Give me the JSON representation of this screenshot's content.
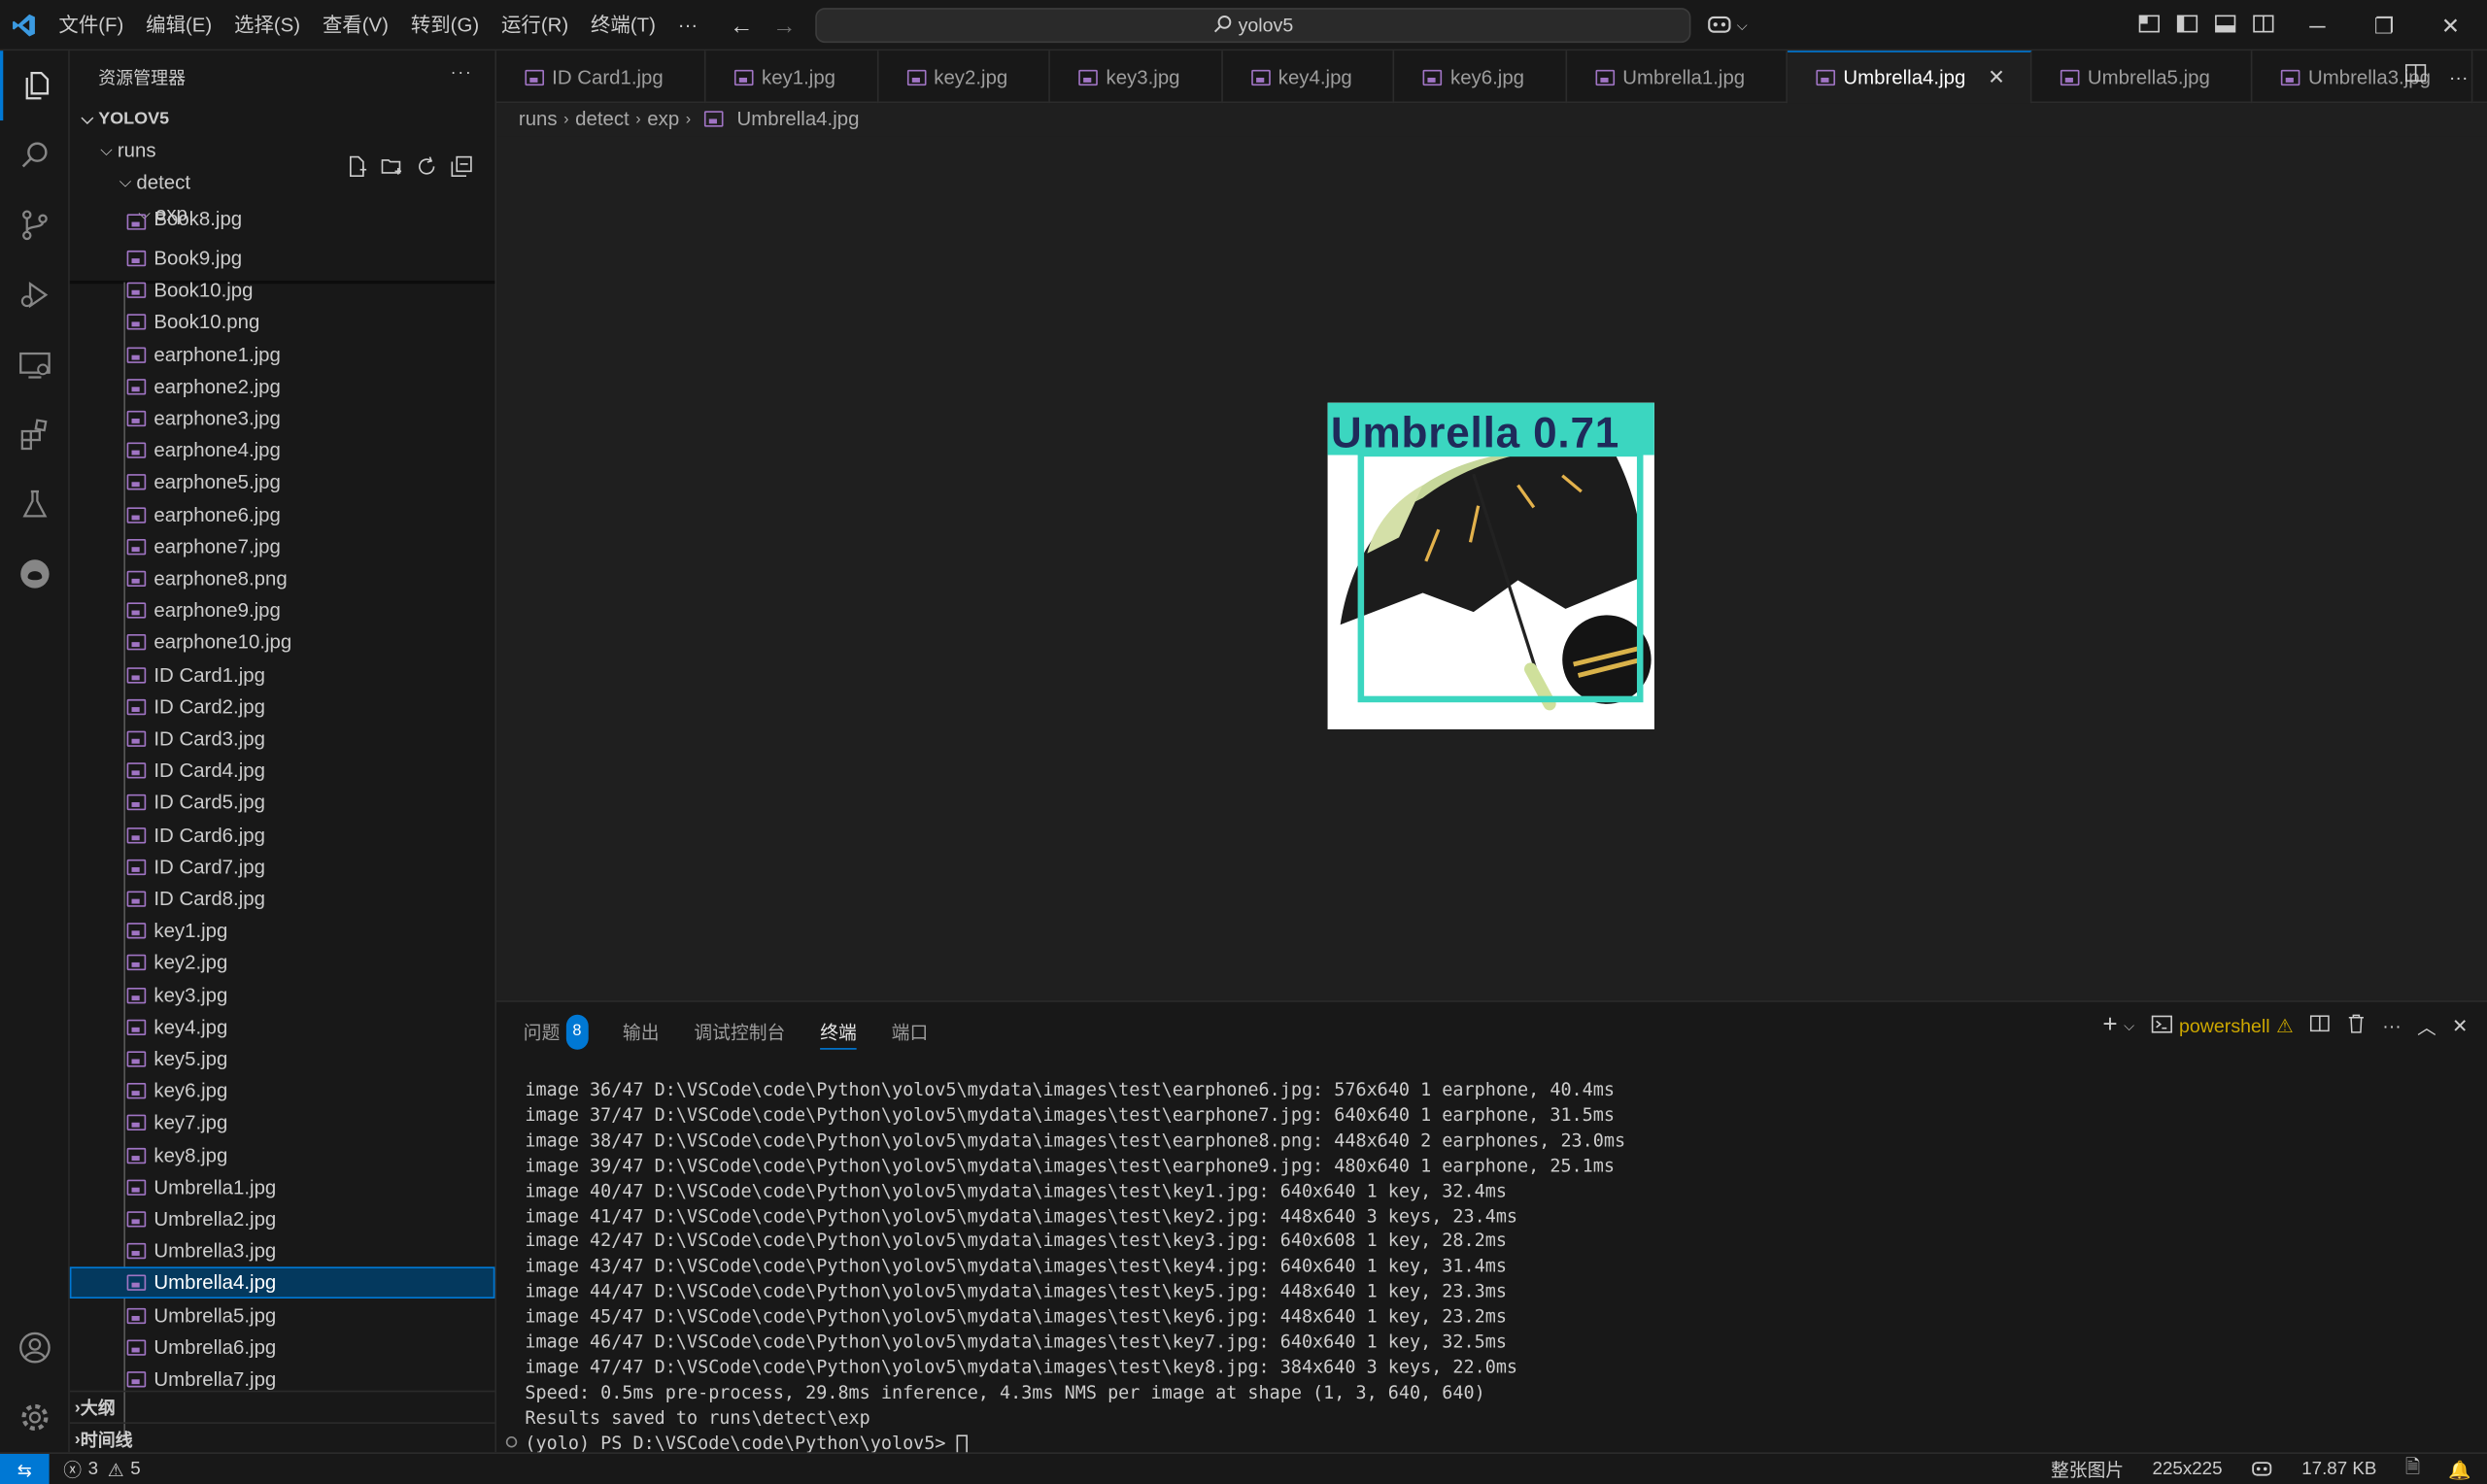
{
  "titlebar": {
    "menus": [
      "文件(F)",
      "编辑(E)",
      "选择(S)",
      "查看(V)",
      "转到(G)",
      "运行(R)",
      "终端(T)",
      "···"
    ],
    "search_text": "yolov5"
  },
  "sidebar": {
    "header": "资源管理器",
    "more": "···",
    "workspace": "YOLOV5",
    "folders": [
      "runs",
      "detect",
      "exp"
    ],
    "partial_top": "Book8.jpg",
    "files": [
      "Book9.jpg",
      "Book10.jpg",
      "Book10.png",
      "earphone1.jpg",
      "earphone2.jpg",
      "earphone3.jpg",
      "earphone4.jpg",
      "earphone5.jpg",
      "earphone6.jpg",
      "earphone7.jpg",
      "earphone8.png",
      "earphone9.jpg",
      "earphone10.jpg",
      "ID Card1.jpg",
      "ID Card2.jpg",
      "ID Card3.jpg",
      "ID Card4.jpg",
      "ID Card5.jpg",
      "ID Card6.jpg",
      "ID Card7.jpg",
      "ID Card8.jpg",
      "key1.jpg",
      "key2.jpg",
      "key3.jpg",
      "key4.jpg",
      "key5.jpg",
      "key6.jpg",
      "key7.jpg",
      "key8.jpg",
      "Umbrella1.jpg",
      "Umbrella2.jpg",
      "Umbrella3.jpg",
      "Umbrella4.jpg",
      "Umbrella5.jpg",
      "Umbrella6.jpg",
      "Umbrella7.jpg"
    ],
    "selected_file": "Umbrella4.jpg",
    "outline": "大纲",
    "timeline": "时间线"
  },
  "tabs": [
    "ID Card1.jpg",
    "key1.jpg",
    "key2.jpg",
    "key3.jpg",
    "key4.jpg",
    "key6.jpg",
    "Umbrella1.jpg",
    "Umbrella4.jpg",
    "Umbrella5.jpg",
    "Umbrella3.jpg"
  ],
  "active_tab": "Umbrella4.jpg",
  "breadcrumb": [
    "runs",
    "detect",
    "exp",
    "Umbrella4.jpg"
  ],
  "preview": {
    "detection_label": "Umbrella 0.71"
  },
  "panel": {
    "tabs": [
      "问题",
      "输出",
      "调试控制台",
      "终端",
      "端口"
    ],
    "problems_count": "8",
    "active_tab": "终端",
    "shell": "powershell",
    "terminal_lines": [
      "image 36/47 D:\\VSCode\\code\\Python\\yolov5\\mydata\\images\\test\\earphone6.jpg: 576x640 1 earphone, 40.4ms",
      "image 37/47 D:\\VSCode\\code\\Python\\yolov5\\mydata\\images\\test\\earphone7.jpg: 640x640 1 earphone, 31.5ms",
      "image 38/47 D:\\VSCode\\code\\Python\\yolov5\\mydata\\images\\test\\earphone8.png: 448x640 2 earphones, 23.0ms",
      "image 39/47 D:\\VSCode\\code\\Python\\yolov5\\mydata\\images\\test\\earphone9.jpg: 480x640 1 earphone, 25.1ms",
      "image 40/47 D:\\VSCode\\code\\Python\\yolov5\\mydata\\images\\test\\key1.jpg: 640x640 1 key, 32.4ms",
      "image 41/47 D:\\VSCode\\code\\Python\\yolov5\\mydata\\images\\test\\key2.jpg: 448x640 3 keys, 23.4ms",
      "image 42/47 D:\\VSCode\\code\\Python\\yolov5\\mydata\\images\\test\\key3.jpg: 640x608 1 key, 28.2ms",
      "image 43/47 D:\\VSCode\\code\\Python\\yolov5\\mydata\\images\\test\\key4.jpg: 640x640 1 key, 31.4ms",
      "image 44/47 D:\\VSCode\\code\\Python\\yolov5\\mydata\\images\\test\\key5.jpg: 448x640 1 key, 23.3ms",
      "image 45/47 D:\\VSCode\\code\\Python\\yolov5\\mydata\\images\\test\\key6.jpg: 448x640 1 key, 23.2ms",
      "image 46/47 D:\\VSCode\\code\\Python\\yolov5\\mydata\\images\\test\\key7.jpg: 640x640 1 key, 32.5ms",
      "image 47/47 D:\\VSCode\\code\\Python\\yolov5\\mydata\\images\\test\\key8.jpg: 384x640 3 keys, 22.0ms",
      "Speed: 0.5ms pre-process, 29.8ms inference, 4.3ms NMS per image at shape (1, 3, 640, 640)",
      "Results saved to runs\\detect\\exp",
      "(yolo) PS D:\\VSCode\\code\\Python\\yolov5> "
    ]
  },
  "statusbar": {
    "errors": "3",
    "warnings": "5",
    "image_mode": "整张图片",
    "dimensions": "225x225",
    "file_size": "17.87 KB"
  },
  "colors": {
    "accent": "#0078d4",
    "detection_box": "#3bd6c0",
    "image_file_icon": "#a074c4"
  }
}
